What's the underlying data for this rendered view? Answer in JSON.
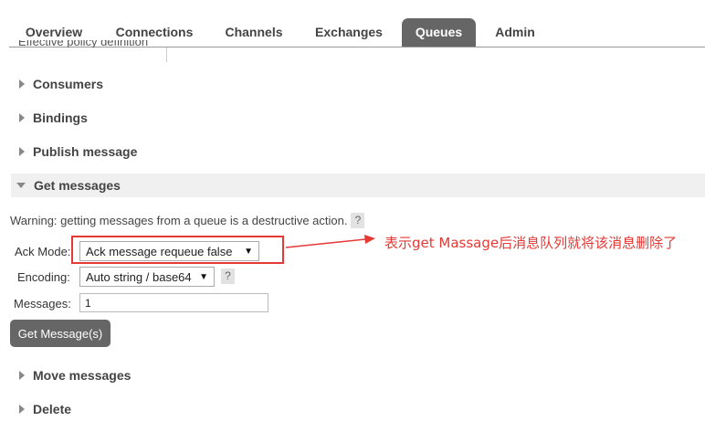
{
  "nav": {
    "tabs": [
      {
        "label": "Overview"
      },
      {
        "label": "Connections"
      },
      {
        "label": "Channels"
      },
      {
        "label": "Exchanges"
      },
      {
        "label": "Queues",
        "active": true
      },
      {
        "label": "Admin"
      }
    ]
  },
  "cut_off_row": {
    "label": "Effective policy definition"
  },
  "sections": {
    "consumers": "Consumers",
    "bindings": "Bindings",
    "publish": "Publish message",
    "get": "Get messages",
    "move": "Move messages",
    "delete": "Delete"
  },
  "get_messages": {
    "warning": "Warning: getting messages from a queue is a destructive action.",
    "help_glyph": "?",
    "ack_mode_label": "Ack Mode:",
    "ack_mode_value": "Ack message requeue false",
    "encoding_label": "Encoding:",
    "encoding_value": "Auto string / base64",
    "messages_label": "Messages:",
    "messages_value": "1",
    "button_label": "Get Message(s)"
  },
  "annotation": {
    "text": "表示get Massage后消息队列就将该消息删除了",
    "color": "#e53935"
  }
}
